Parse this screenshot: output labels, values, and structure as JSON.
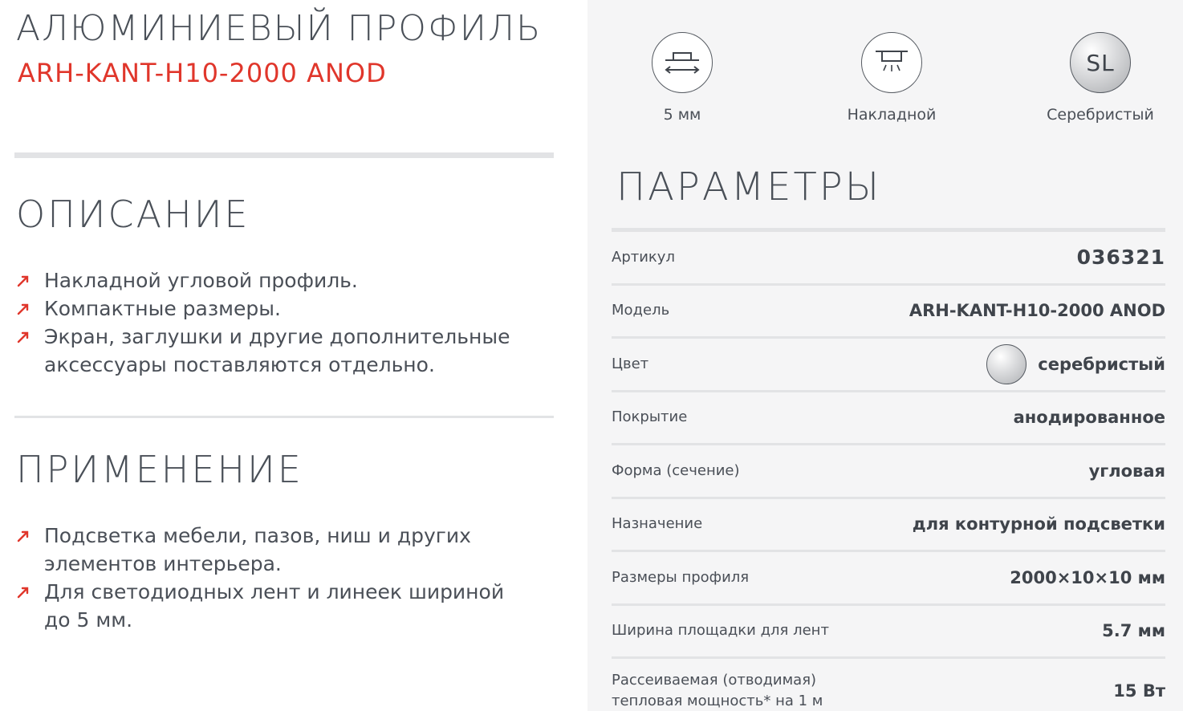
{
  "header": {
    "title": "АЛЮМИНИЕВЫЙ ПРОФИЛЬ",
    "model": "ARH-KANT-H10-2000 ANOD"
  },
  "description": {
    "heading": "ОПИСАНИЕ",
    "items": [
      "Накладной угловой профиль.",
      "Компактные размеры.",
      "Экран, заглушки и другие дополнительные аксессуары поставляются отдельно."
    ]
  },
  "application": {
    "heading": "ПРИМЕНЕНИЕ",
    "items": [
      "Подсветка мебели, пазов, ниш и других элементов интерьера.",
      "Для светодиодных лент и линеек шириной до 5 мм."
    ]
  },
  "features": [
    {
      "icon": "width-icon",
      "label": "5 мм"
    },
    {
      "icon": "surface-mount-icon",
      "label": "Накладной"
    },
    {
      "icon": "silver-color-icon",
      "text": "SL",
      "label": "Серебристый"
    }
  ],
  "parameters": {
    "heading": "ПАРАМЕТРЫ",
    "rows": [
      {
        "key": "Артикул",
        "value": "036321"
      },
      {
        "key": "Модель",
        "value": "ARH-KANT-H10-2000 ANOD"
      },
      {
        "key": "Цвет",
        "value": "серебристый"
      },
      {
        "key": "Покрытие",
        "value": "анодированное"
      },
      {
        "key": "Форма (сечение)",
        "value": "угловая"
      },
      {
        "key": "Назначение",
        "value": "для контурной подсветки"
      },
      {
        "key": "Размеры профиля",
        "value": "2000×10×10 мм"
      },
      {
        "key": "Ширина площадки для лент",
        "value": "5.7 мм"
      },
      {
        "key_line1": "Рассеиваемая (отводимая)",
        "key_line2": "тепловая мощность* на 1 м",
        "value": "15 Вт"
      }
    ]
  },
  "colors": {
    "accent": "#e0362b",
    "text": "#4a4f57",
    "panel": "#f5f5f6",
    "rule": "#e2e3e5"
  }
}
